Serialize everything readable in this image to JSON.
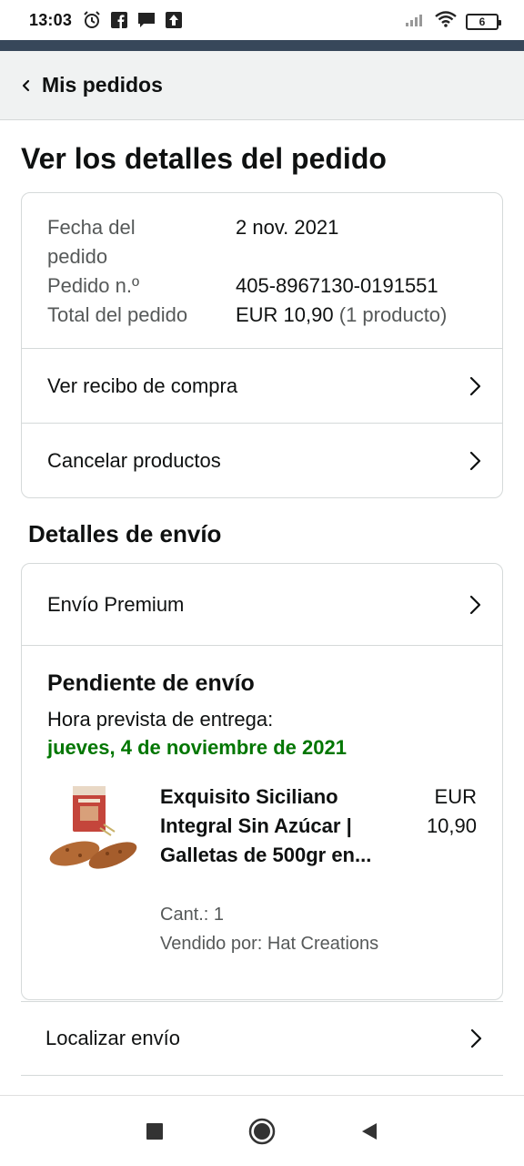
{
  "status_bar": {
    "time": "13:03",
    "battery": "6",
    "icons": [
      "alarm-icon",
      "facebook-icon",
      "message-icon",
      "upload-icon",
      "signal-icon",
      "wifi-icon",
      "battery-icon"
    ]
  },
  "header": {
    "back_label": "Mis pedidos"
  },
  "page": {
    "title": "Ver los detalles del pedido"
  },
  "order_info": {
    "rows": [
      {
        "label": "Fecha del pedido",
        "value": "2 nov. 2021"
      },
      {
        "label": "Pedido n.º",
        "value": "405-8967130-0191551"
      },
      {
        "label": "Total del pedido",
        "value": "EUR 10,90",
        "value_extra": "(1 producto)"
      }
    ],
    "links": [
      {
        "label": "Ver recibo de compra"
      },
      {
        "label": "Cancelar productos"
      }
    ]
  },
  "shipping": {
    "section_title": "Detalles de envío",
    "method": "Envío Premium",
    "status": "Pendiente de envío",
    "eta_label": "Hora prevista de entrega:",
    "eta_date": "jueves, 4 de noviembre de 2021",
    "product": {
      "name": "Exquisito Siciliano Integral Sin Azúcar | Galletas de 500gr en...",
      "price": "EUR 10,90",
      "quantity": "Cant.: 1",
      "seller": "Vendido por: Hat Creations"
    },
    "track_label": "Localizar envío"
  },
  "colors": {
    "accent_green": "#007600",
    "header_bg": "#f0f2f2",
    "navy_strip": "#37475a",
    "border": "#d5d9d9"
  },
  "nav_bar": {
    "buttons": [
      "recents-square-icon",
      "home-circle-icon",
      "back-triangle-icon"
    ]
  }
}
